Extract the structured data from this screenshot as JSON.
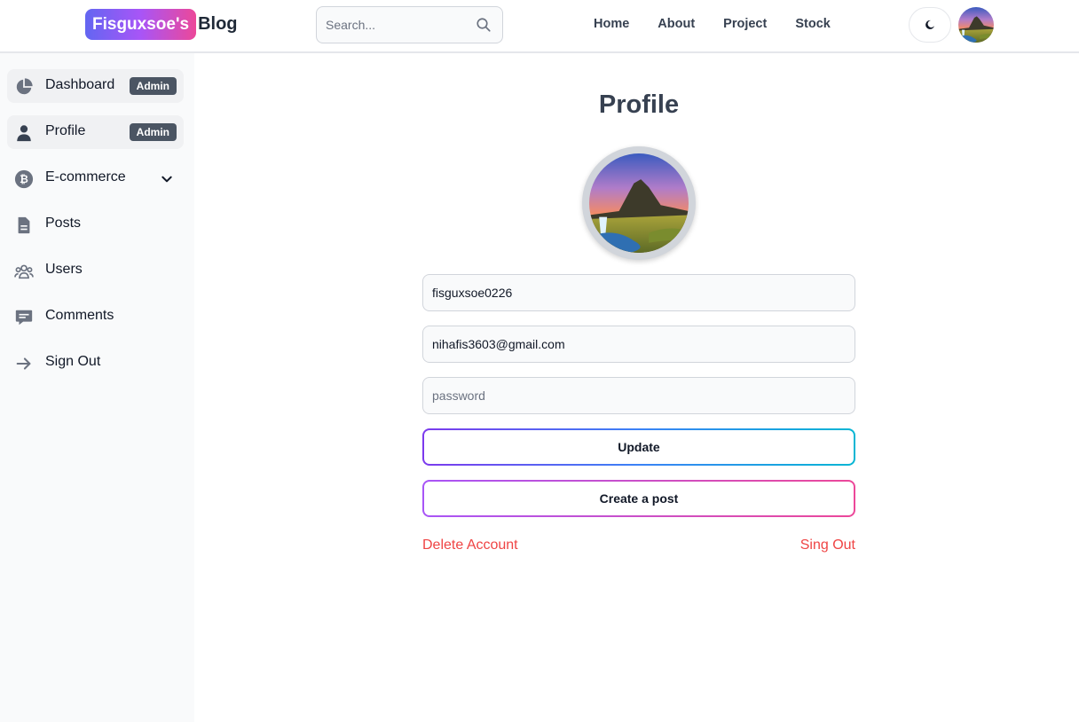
{
  "header": {
    "brand_badge": "Fisguxsoe's",
    "brand_text": "Blog",
    "search_placeholder": "Search...",
    "nav": [
      "Home",
      "About",
      "Project",
      "Stock"
    ],
    "theme_icon": "moon-icon"
  },
  "sidebar": {
    "items": [
      {
        "label": "Dashboard",
        "icon": "pie-chart-icon",
        "badge": "Admin",
        "active": true
      },
      {
        "label": "Profile",
        "icon": "user-icon",
        "badge": "Admin",
        "active": true
      },
      {
        "label": "E-commerce",
        "icon": "bitcoin-icon",
        "expandable": true
      },
      {
        "label": "Posts",
        "icon": "document-icon"
      },
      {
        "label": "Users",
        "icon": "users-icon"
      },
      {
        "label": "Comments",
        "icon": "comment-icon"
      },
      {
        "label": "Sign Out",
        "icon": "arrow-right-icon"
      }
    ]
  },
  "main": {
    "title": "Profile",
    "username_value": "fisguxsoe0226",
    "email_value": "nihafis3603@gmail.com",
    "password_placeholder": "password",
    "update_label": "Update",
    "create_post_label": "Create a post",
    "delete_label": "Delete Account",
    "signout_label": "Sing Out"
  },
  "colors": {
    "danger": "#ef4444",
    "badge_bg": "#4b5563",
    "brand_gradient_start": "#6366f1",
    "brand_gradient_end": "#ec4899"
  }
}
